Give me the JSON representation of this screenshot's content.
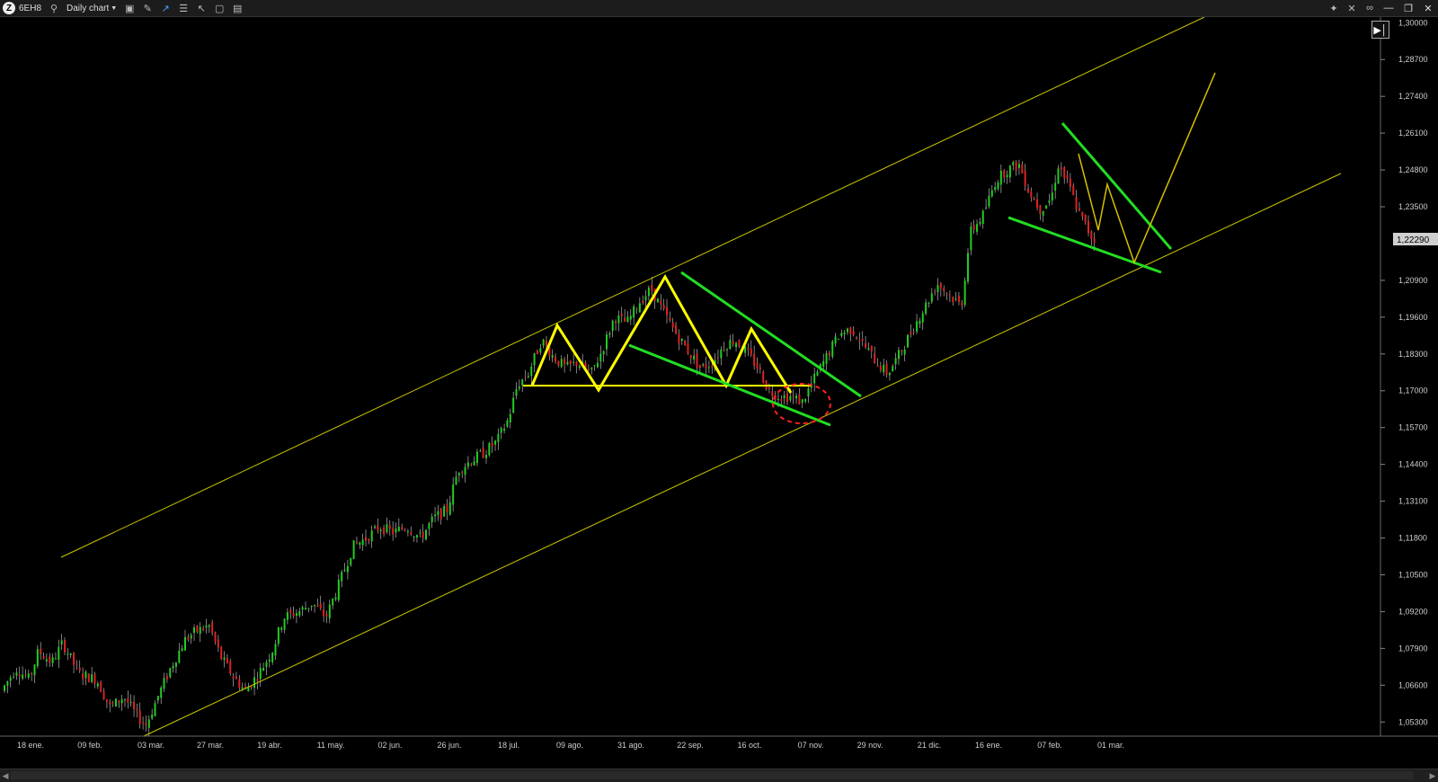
{
  "toolbar": {
    "symbol": "6EH8",
    "chart_label": "Daily chart",
    "icons": [
      "search-icon",
      "display-icon",
      "draw-icon",
      "line-chart-icon",
      "bars-icon",
      "cursor-icon",
      "window-icon",
      "split-icon"
    ],
    "right_icons": [
      "settings-icon",
      "crosshair-icon",
      "link-icon"
    ],
    "window_buttons": [
      "minimize",
      "restore",
      "close"
    ]
  },
  "price_axis": {
    "labels": [
      "1,30000",
      "1,28700",
      "1,27400",
      "1,26100",
      "1,24800",
      "1,23500",
      "1,22290",
      "1,20900",
      "1,19600",
      "1,18300",
      "1,17000",
      "1,15700",
      "1,14400",
      "1,13100",
      "1,11800",
      "1,10500",
      "1,09200",
      "1,07900",
      "1,06600",
      "1,05300"
    ],
    "current_price": "1,22290"
  },
  "time_axis": {
    "labels": [
      "18 ene.",
      "09 feb.",
      "03 mar.",
      "27 mar.",
      "19 abr.",
      "11 may.",
      "02 jun.",
      "26 jun.",
      "18 jul.",
      "09 ago.",
      "31 ago.",
      "22 sep.",
      "16 oct.",
      "07 nov.",
      "29 nov.",
      "21 dic.",
      "16 ene.",
      "07 feb.",
      "01 mar."
    ]
  },
  "colors": {
    "background": "#000000",
    "up_candle": "#22cc22",
    "down_candle": "#dd2222",
    "channel": "#c8c800",
    "pattern": "#ffff00",
    "wedge": "#22dd22",
    "circle": "#ff2020"
  },
  "chart_data": {
    "type": "candlestick",
    "instrument": "6EH8",
    "timeframe": "Daily chart",
    "ylim": [
      1.048,
      1.302
    ],
    "last_price": 1.2229,
    "path": [
      [
        0,
        1.062
      ],
      [
        20,
        1.072
      ],
      [
        35,
        1.068
      ],
      [
        45,
        1.078
      ],
      [
        60,
        1.074
      ],
      [
        72,
        1.081
      ],
      [
        90,
        1.07
      ],
      [
        110,
        1.068
      ],
      [
        125,
        1.058
      ],
      [
        140,
        1.062
      ],
      [
        155,
        1.055
      ],
      [
        165,
        1.052
      ],
      [
        178,
        1.062
      ],
      [
        192,
        1.072
      ],
      [
        208,
        1.082
      ],
      [
        220,
        1.085
      ],
      [
        235,
        1.087
      ],
      [
        248,
        1.076
      ],
      [
        262,
        1.069
      ],
      [
        275,
        1.064
      ],
      [
        290,
        1.07
      ],
      [
        305,
        1.078
      ],
      [
        318,
        1.09
      ],
      [
        335,
        1.092
      ],
      [
        350,
        1.095
      ],
      [
        365,
        1.09
      ],
      [
        380,
        1.102
      ],
      [
        395,
        1.115
      ],
      [
        410,
        1.118
      ],
      [
        425,
        1.122
      ],
      [
        440,
        1.12
      ],
      [
        455,
        1.122
      ],
      [
        470,
        1.118
      ],
      [
        485,
        1.125
      ],
      [
        500,
        1.128
      ],
      [
        512,
        1.142
      ],
      [
        525,
        1.145
      ],
      [
        540,
        1.148
      ],
      [
        555,
        1.152
      ],
      [
        568,
        1.16
      ],
      [
        578,
        1.172
      ],
      [
        590,
        1.176
      ],
      [
        605,
        1.188
      ],
      [
        618,
        1.182
      ],
      [
        632,
        1.178
      ],
      [
        645,
        1.18
      ],
      [
        660,
        1.176
      ],
      [
        672,
        1.184
      ],
      [
        686,
        1.196
      ],
      [
        700,
        1.194
      ],
      [
        715,
        1.202
      ],
      [
        727,
        1.206
      ],
      [
        740,
        1.198
      ],
      [
        755,
        1.19
      ],
      [
        768,
        1.184
      ],
      [
        782,
        1.178
      ],
      [
        795,
        1.18
      ],
      [
        808,
        1.186
      ],
      [
        820,
        1.188
      ],
      [
        832,
        1.184
      ],
      [
        846,
        1.178
      ],
      [
        858,
        1.17
      ],
      [
        870,
        1.168
      ],
      [
        882,
        1.168
      ],
      [
        895,
        1.166
      ],
      [
        908,
        1.174
      ],
      [
        922,
        1.182
      ],
      [
        936,
        1.19
      ],
      [
        950,
        1.192
      ],
      [
        964,
        1.186
      ],
      [
        978,
        1.18
      ],
      [
        990,
        1.176
      ],
      [
        1005,
        1.184
      ],
      [
        1018,
        1.192
      ],
      [
        1032,
        1.2
      ],
      [
        1045,
        1.208
      ],
      [
        1058,
        1.204
      ],
      [
        1072,
        1.2
      ],
      [
        1082,
        1.226
      ],
      [
        1096,
        1.232
      ],
      [
        1110,
        1.244
      ],
      [
        1122,
        1.248
      ],
      [
        1136,
        1.25
      ],
      [
        1148,
        1.24
      ],
      [
        1160,
        1.234
      ],
      [
        1172,
        1.238
      ],
      [
        1180,
        1.25
      ],
      [
        1192,
        1.242
      ],
      [
        1204,
        1.232
      ],
      [
        1214,
        1.226
      ],
      [
        1220,
        1.2229
      ]
    ]
  }
}
